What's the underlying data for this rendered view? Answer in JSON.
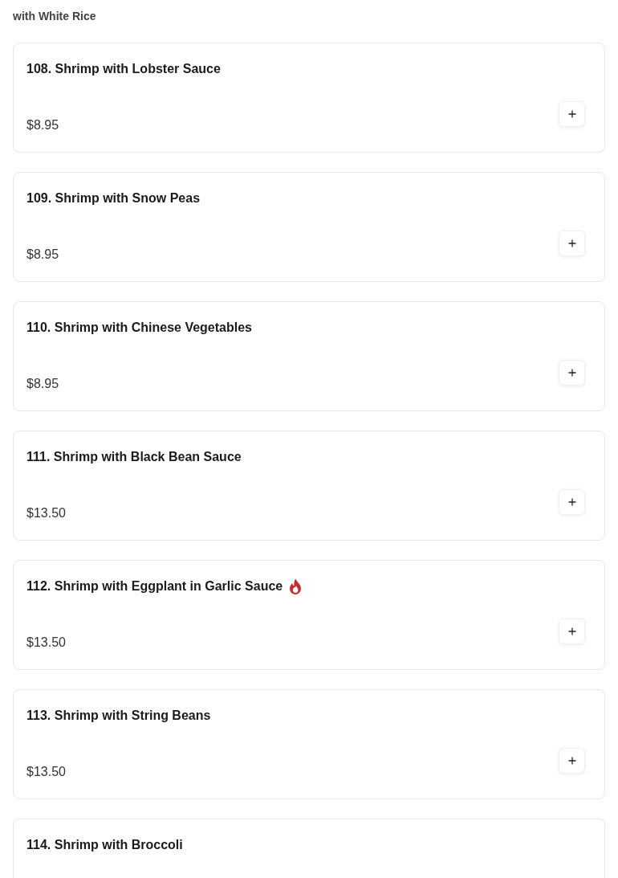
{
  "section_note": "with White Rice",
  "items": [
    {
      "name": "108. Shrimp with Lobster Sauce",
      "price": "$8.95",
      "spicy": false
    },
    {
      "name": "109. Shrimp with Snow Peas",
      "price": "$8.95",
      "spicy": false
    },
    {
      "name": "110. Shrimp with Chinese Vegetables",
      "price": "$8.95",
      "spicy": false
    },
    {
      "name": "111. Shrimp with Black Bean Sauce",
      "price": "$13.50",
      "spicy": false
    },
    {
      "name": "112. Shrimp with Eggplant in Garlic Sauce",
      "price": "$13.50",
      "spicy": true
    },
    {
      "name": "113. Shrimp with String Beans",
      "price": "$13.50",
      "spicy": false
    },
    {
      "name": "114. Shrimp with Broccoli",
      "spicy": false
    }
  ]
}
